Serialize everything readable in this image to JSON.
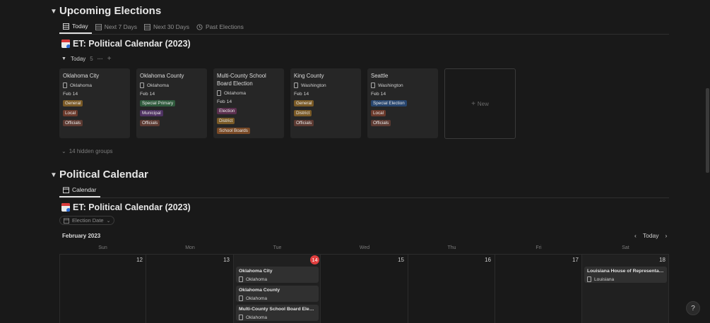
{
  "upcoming": {
    "section_title": "Upcoming Elections",
    "tabs": [
      {
        "label": "Today",
        "icon": "table-icon",
        "active": true
      },
      {
        "label": "Next 7 Days",
        "icon": "table-icon",
        "active": false
      },
      {
        "label": "Next 30 Days",
        "icon": "table-icon",
        "active": false
      },
      {
        "label": "Past Elections",
        "icon": "history-icon",
        "active": false
      }
    ],
    "db_title": "ET: Political Calendar (2023)",
    "group": {
      "label": "Today",
      "count": "5"
    },
    "cards": [
      {
        "title": "Oklahoma City",
        "location": "Oklahoma",
        "date": "Feb 14",
        "tags": [
          "General",
          "Local",
          "Officials"
        ]
      },
      {
        "title": "Oklahoma County",
        "location": "Oklahoma",
        "date": "Feb 14",
        "tags": [
          "Special Primary",
          "Municipal",
          "Officials"
        ]
      },
      {
        "title": "Multi-County School Board Election",
        "location": "Oklahoma",
        "date": "Feb 14",
        "tags": [
          "Election",
          "District",
          "School Boards"
        ]
      },
      {
        "title": "King County",
        "location": "Washington",
        "date": "Feb 14",
        "tags": [
          "General",
          "District",
          "Officials"
        ]
      },
      {
        "title": "Seattle",
        "location": "Washington",
        "date": "Feb 14",
        "tags": [
          "Special Election",
          "Local",
          "Officials"
        ]
      }
    ],
    "new_label": "New",
    "hidden_groups": "14 hidden groups"
  },
  "tag_colors": {
    "General": "#7a5a26",
    "Local": "#6b3a2c",
    "Officials": "#5c3a32",
    "Special Primary": "#2f5a3c",
    "Municipal": "#4e3262",
    "Election": "#5a2f4e",
    "District": "#7a5a26",
    "School Boards": "#7a4a26",
    "Special Election": "#27456e"
  },
  "political": {
    "section_title": "Political Calendar",
    "tab": {
      "label": "Calendar",
      "icon": "calendar-icon"
    },
    "db_title": "ET: Political Calendar (2023)",
    "filter_label": "Election Date",
    "month": "February 2023",
    "today_label": "Today",
    "weekdays": [
      "Sun",
      "Mon",
      "Tue",
      "Wed",
      "Thu",
      "Fri",
      "Sat"
    ],
    "days": [
      "12",
      "13",
      "14",
      "15",
      "16",
      "17",
      "18"
    ],
    "today_index": 2,
    "events_tue": [
      {
        "title": "Oklahoma City",
        "location": "Oklahoma"
      },
      {
        "title": "Oklahoma County",
        "location": "Oklahoma"
      },
      {
        "title": "Multi-County School Board Election",
        "location": "Oklahoma"
      }
    ],
    "events_sat": [
      {
        "title": "Louisiana House of Representatives",
        "location": "Louisiana"
      }
    ]
  },
  "help_label": "?"
}
